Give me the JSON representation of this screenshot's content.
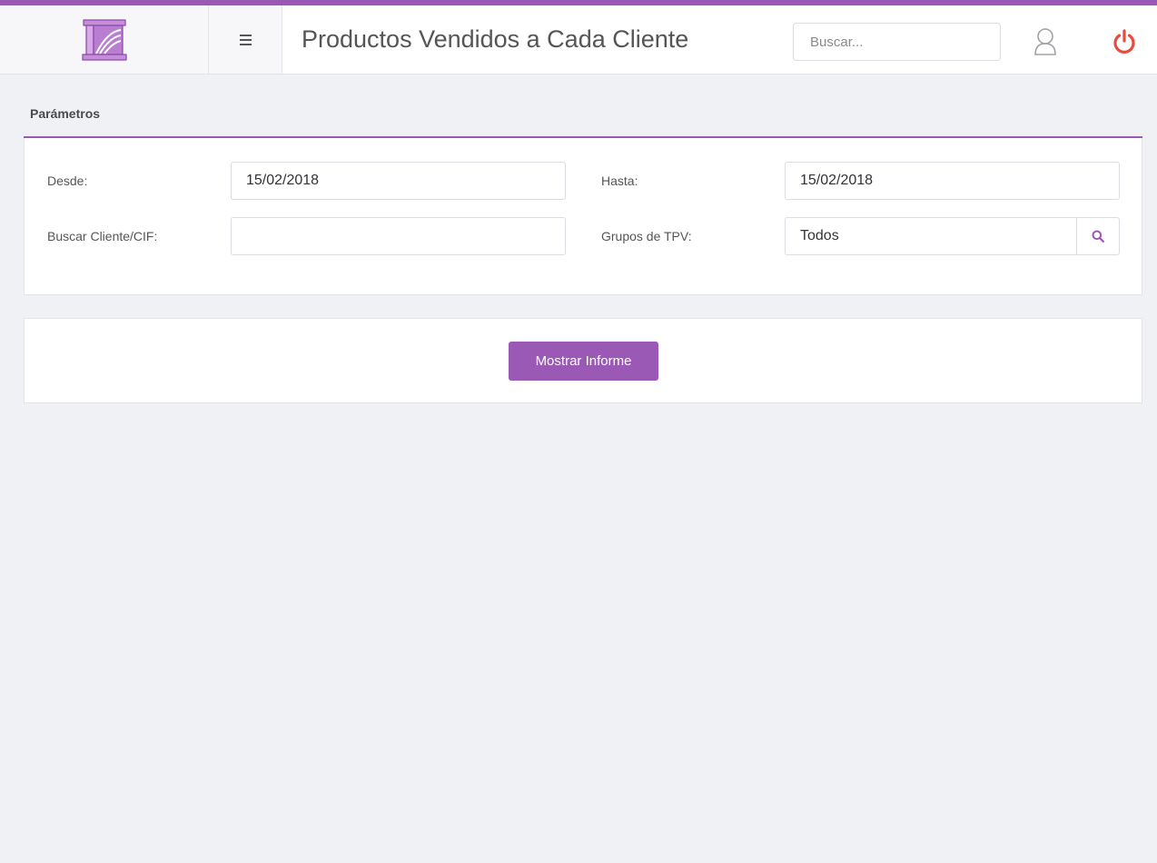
{
  "header": {
    "logo_icon": "building-logo-icon",
    "menu_icon": "hamburger-menu-icon",
    "title": "Productos Vendidos a Cada Cliente",
    "search_placeholder": "Buscar...",
    "user_icon": "user-icon",
    "power_icon": "power-icon"
  },
  "params": {
    "title": "Parámetros",
    "desde_label": "Desde:",
    "desde_value": "15/02/2018",
    "hasta_label": "Hasta:",
    "hasta_value": "15/02/2018",
    "cliente_label": "Buscar Cliente/CIF:",
    "cliente_value": "",
    "grupos_label": "Grupos de TPV:",
    "grupos_value": "Todos",
    "grupos_search_icon": "search-icon"
  },
  "actions": {
    "mostrar_label": "Mostrar Informe"
  },
  "colors": {
    "accent": "#9b59b6",
    "power": "#e74c3c",
    "background": "#f0f1f5"
  }
}
